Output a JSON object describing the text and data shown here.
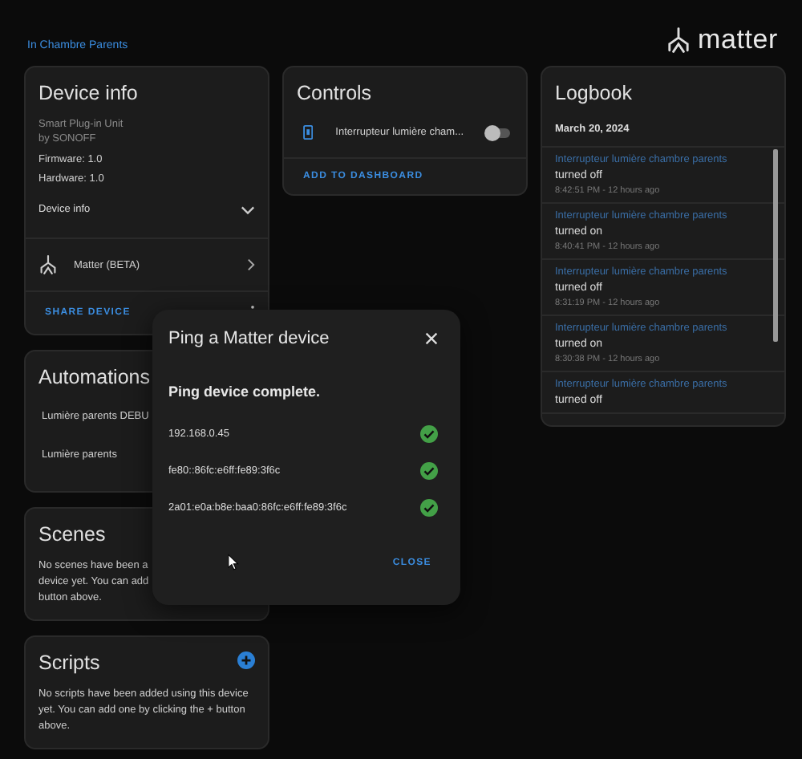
{
  "breadcrumb": "In Chambre Parents",
  "brand": "matter",
  "device_info": {
    "title": "Device info",
    "model": "Smart Plug-in Unit",
    "manufacturer": "by SONOFF",
    "firmware": "Firmware: 1.0",
    "hardware": "Hardware: 1.0",
    "section": {
      "label": "Device info",
      "expanded": false
    },
    "integration": "Matter (BETA)",
    "action": "SHARE DEVICE"
  },
  "automations": {
    "title": "Automations",
    "items": [
      "Lumière parents DEBU",
      "Lumière parents"
    ]
  },
  "scenes": {
    "title": "Scenes",
    "lines": [
      "No scenes have been a",
      "device yet. You can add",
      "button above."
    ]
  },
  "scripts": {
    "title": "Scripts",
    "text": "No scripts have been added using this device yet. You can add one by clicking the + button above."
  },
  "controls": {
    "title": "Controls",
    "entities": [
      {
        "name": "Interrupteur lumière cham...",
        "on": false
      }
    ],
    "action": "ADD TO DASHBOARD"
  },
  "logbook": {
    "title": "Logbook",
    "date": "March 20, 2024",
    "entries": [
      {
        "entity": "Interrupteur lumière chambre parents",
        "event": "turned off",
        "time": "8:42:51 PM - 12 hours ago"
      },
      {
        "entity": "Interrupteur lumière chambre parents",
        "event": "turned on",
        "time": "8:40:41 PM - 12 hours ago"
      },
      {
        "entity": "Interrupteur lumière chambre parents",
        "event": "turned off",
        "time": "8:31:19 PM - 12 hours ago"
      },
      {
        "entity": "Interrupteur lumière chambre parents",
        "event": "turned on",
        "time": "8:30:38 PM - 12 hours ago"
      },
      {
        "entity": "Interrupteur lumière chambre parents",
        "event": "turned off"
      }
    ]
  },
  "dialog": {
    "title": "Ping a Matter device",
    "message": "Ping device complete.",
    "results": [
      {
        "address": "192.168.0.45",
        "ok": true
      },
      {
        "address": "fe80::86fc:e6ff:fe89:3f6c",
        "ok": true
      },
      {
        "address": "2a01:e0a:b8e:baa0:86fc:e6ff:fe89:3f6c",
        "ok": true
      }
    ],
    "action": "CLOSE"
  }
}
